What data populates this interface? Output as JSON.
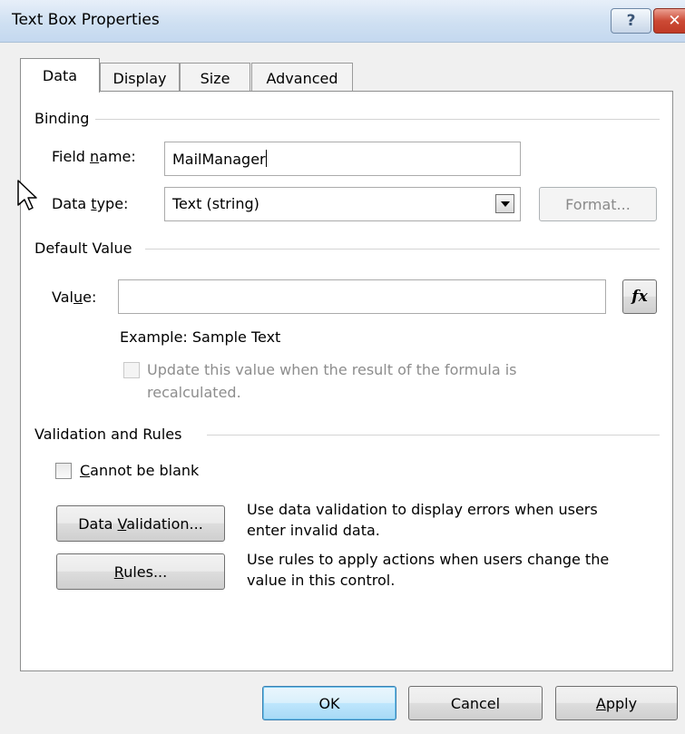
{
  "window": {
    "title": "Text Box Properties",
    "help_label": "?",
    "close_label": "✕"
  },
  "tabs": [
    {
      "label": "Data"
    },
    {
      "label": "Display"
    },
    {
      "label": "Size"
    },
    {
      "label": "Advanced"
    }
  ],
  "binding": {
    "group_title": "Binding",
    "field_name_label": "Field name:",
    "field_name_value": "MailManager",
    "data_type_label": "Data type:",
    "data_type_value": "Text (string)",
    "format_button": "Format..."
  },
  "default_value": {
    "group_title": "Default Value",
    "value_label": "Value:",
    "value": "",
    "fx_label": "fx",
    "example": "Example: Sample Text",
    "update_checkbox_line1": "Update this value when the result of the formula is",
    "update_checkbox_line2": "recalculated."
  },
  "validation": {
    "group_title": "Validation and Rules",
    "cannot_be_blank": "Cannot be blank",
    "data_validation_button": "Data Validation...",
    "data_validation_desc_line1": "Use data validation to display errors when users",
    "data_validation_desc_line2": "enter invalid data.",
    "rules_button": "Rules...",
    "rules_desc_line1": "Use rules to apply actions when users change the",
    "rules_desc_line2": "value in this control."
  },
  "footer": {
    "ok": "OK",
    "cancel": "Cancel",
    "apply": "Apply"
  }
}
